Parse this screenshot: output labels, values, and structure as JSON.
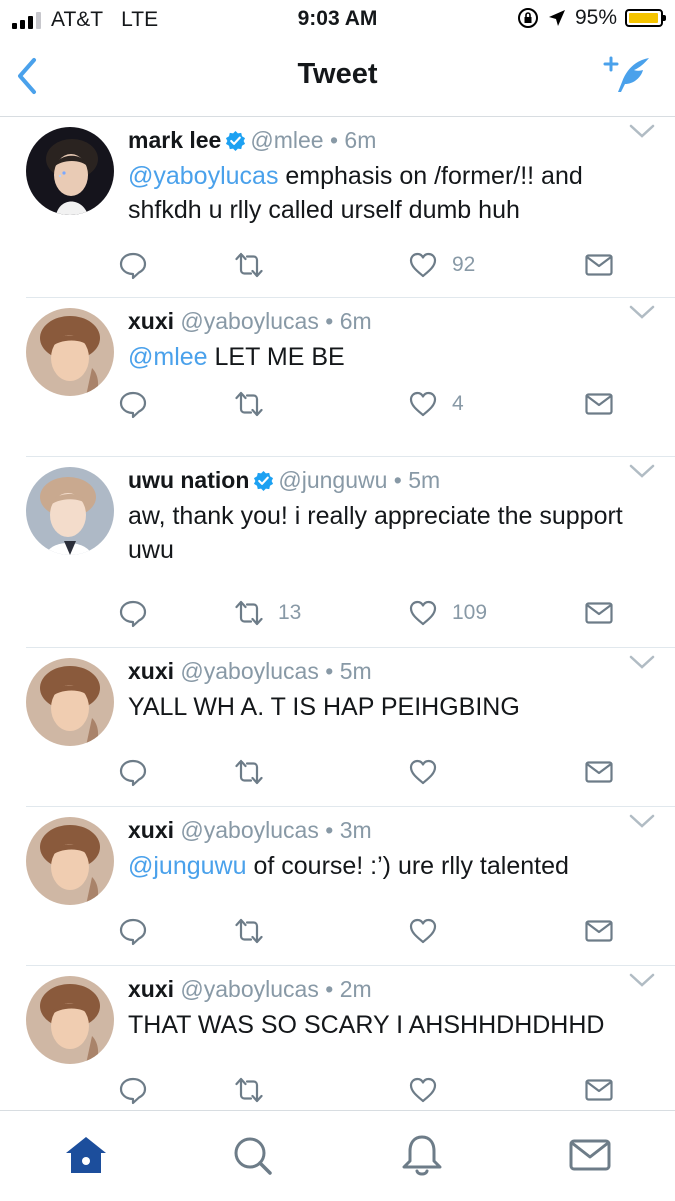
{
  "status_bar": {
    "carrier": "AT&T",
    "network": "LTE",
    "time": "9:03 AM",
    "battery": "95%",
    "battery_level": 0.95
  },
  "nav": {
    "title": "Tweet",
    "back_icon": "chevron-left-icon",
    "compose_icon": "compose-tweet-icon"
  },
  "colors": {
    "accent": "#1da1f2",
    "mention": "#4aa1eb",
    "muted": "#8899a6",
    "battery": "#f5c400",
    "tab_active": "#1c4e9c"
  },
  "tweets": [
    {
      "name": "mark lee",
      "verified": true,
      "handle": "@mlee",
      "dot": "•",
      "time": "6m",
      "mention": "@yaboylucas",
      "text": " emphasis on /former/!! and shfkdh u rlly called urself dumb huh",
      "retweets": "",
      "likes": "92"
    },
    {
      "name": "xuxi",
      "verified": false,
      "handle": "@yaboylucas",
      "dot": "•",
      "time": "6m",
      "mention": "@mlee",
      "text": " LET ME BE",
      "retweets": "",
      "likes": "4"
    },
    {
      "name": "uwu nation",
      "verified": true,
      "handle": "@junguwu",
      "dot": "•",
      "time": "5m",
      "mention": "",
      "text": "aw, thank you! i really appreciate the support uwu",
      "retweets": "13",
      "likes": "109"
    },
    {
      "name": "xuxi",
      "verified": false,
      "handle": "@yaboylucas",
      "dot": "•",
      "time": "5m",
      "mention": "",
      "text": "YALL WH A. T IS HAP PEIHGBING",
      "retweets": "",
      "likes": ""
    },
    {
      "name": "xuxi",
      "verified": false,
      "handle": "@yaboylucas",
      "dot": "•",
      "time": "3m",
      "mention": "@junguwu",
      "text": " of course! :’) ure rlly talented",
      "retweets": "",
      "likes": ""
    },
    {
      "name": "xuxi",
      "verified": false,
      "handle": "@yaboylucas",
      "dot": "•",
      "time": "2m",
      "mention": "",
      "text": "THAT WAS SO SCARY I AHSHHDHDHHD",
      "retweets": "",
      "likes": ""
    }
  ],
  "tabbar": {
    "home_icon": "home-icon",
    "search_icon": "search-icon",
    "notifications_icon": "bell-icon",
    "messages_icon": "mail-icon",
    "active": "home"
  }
}
